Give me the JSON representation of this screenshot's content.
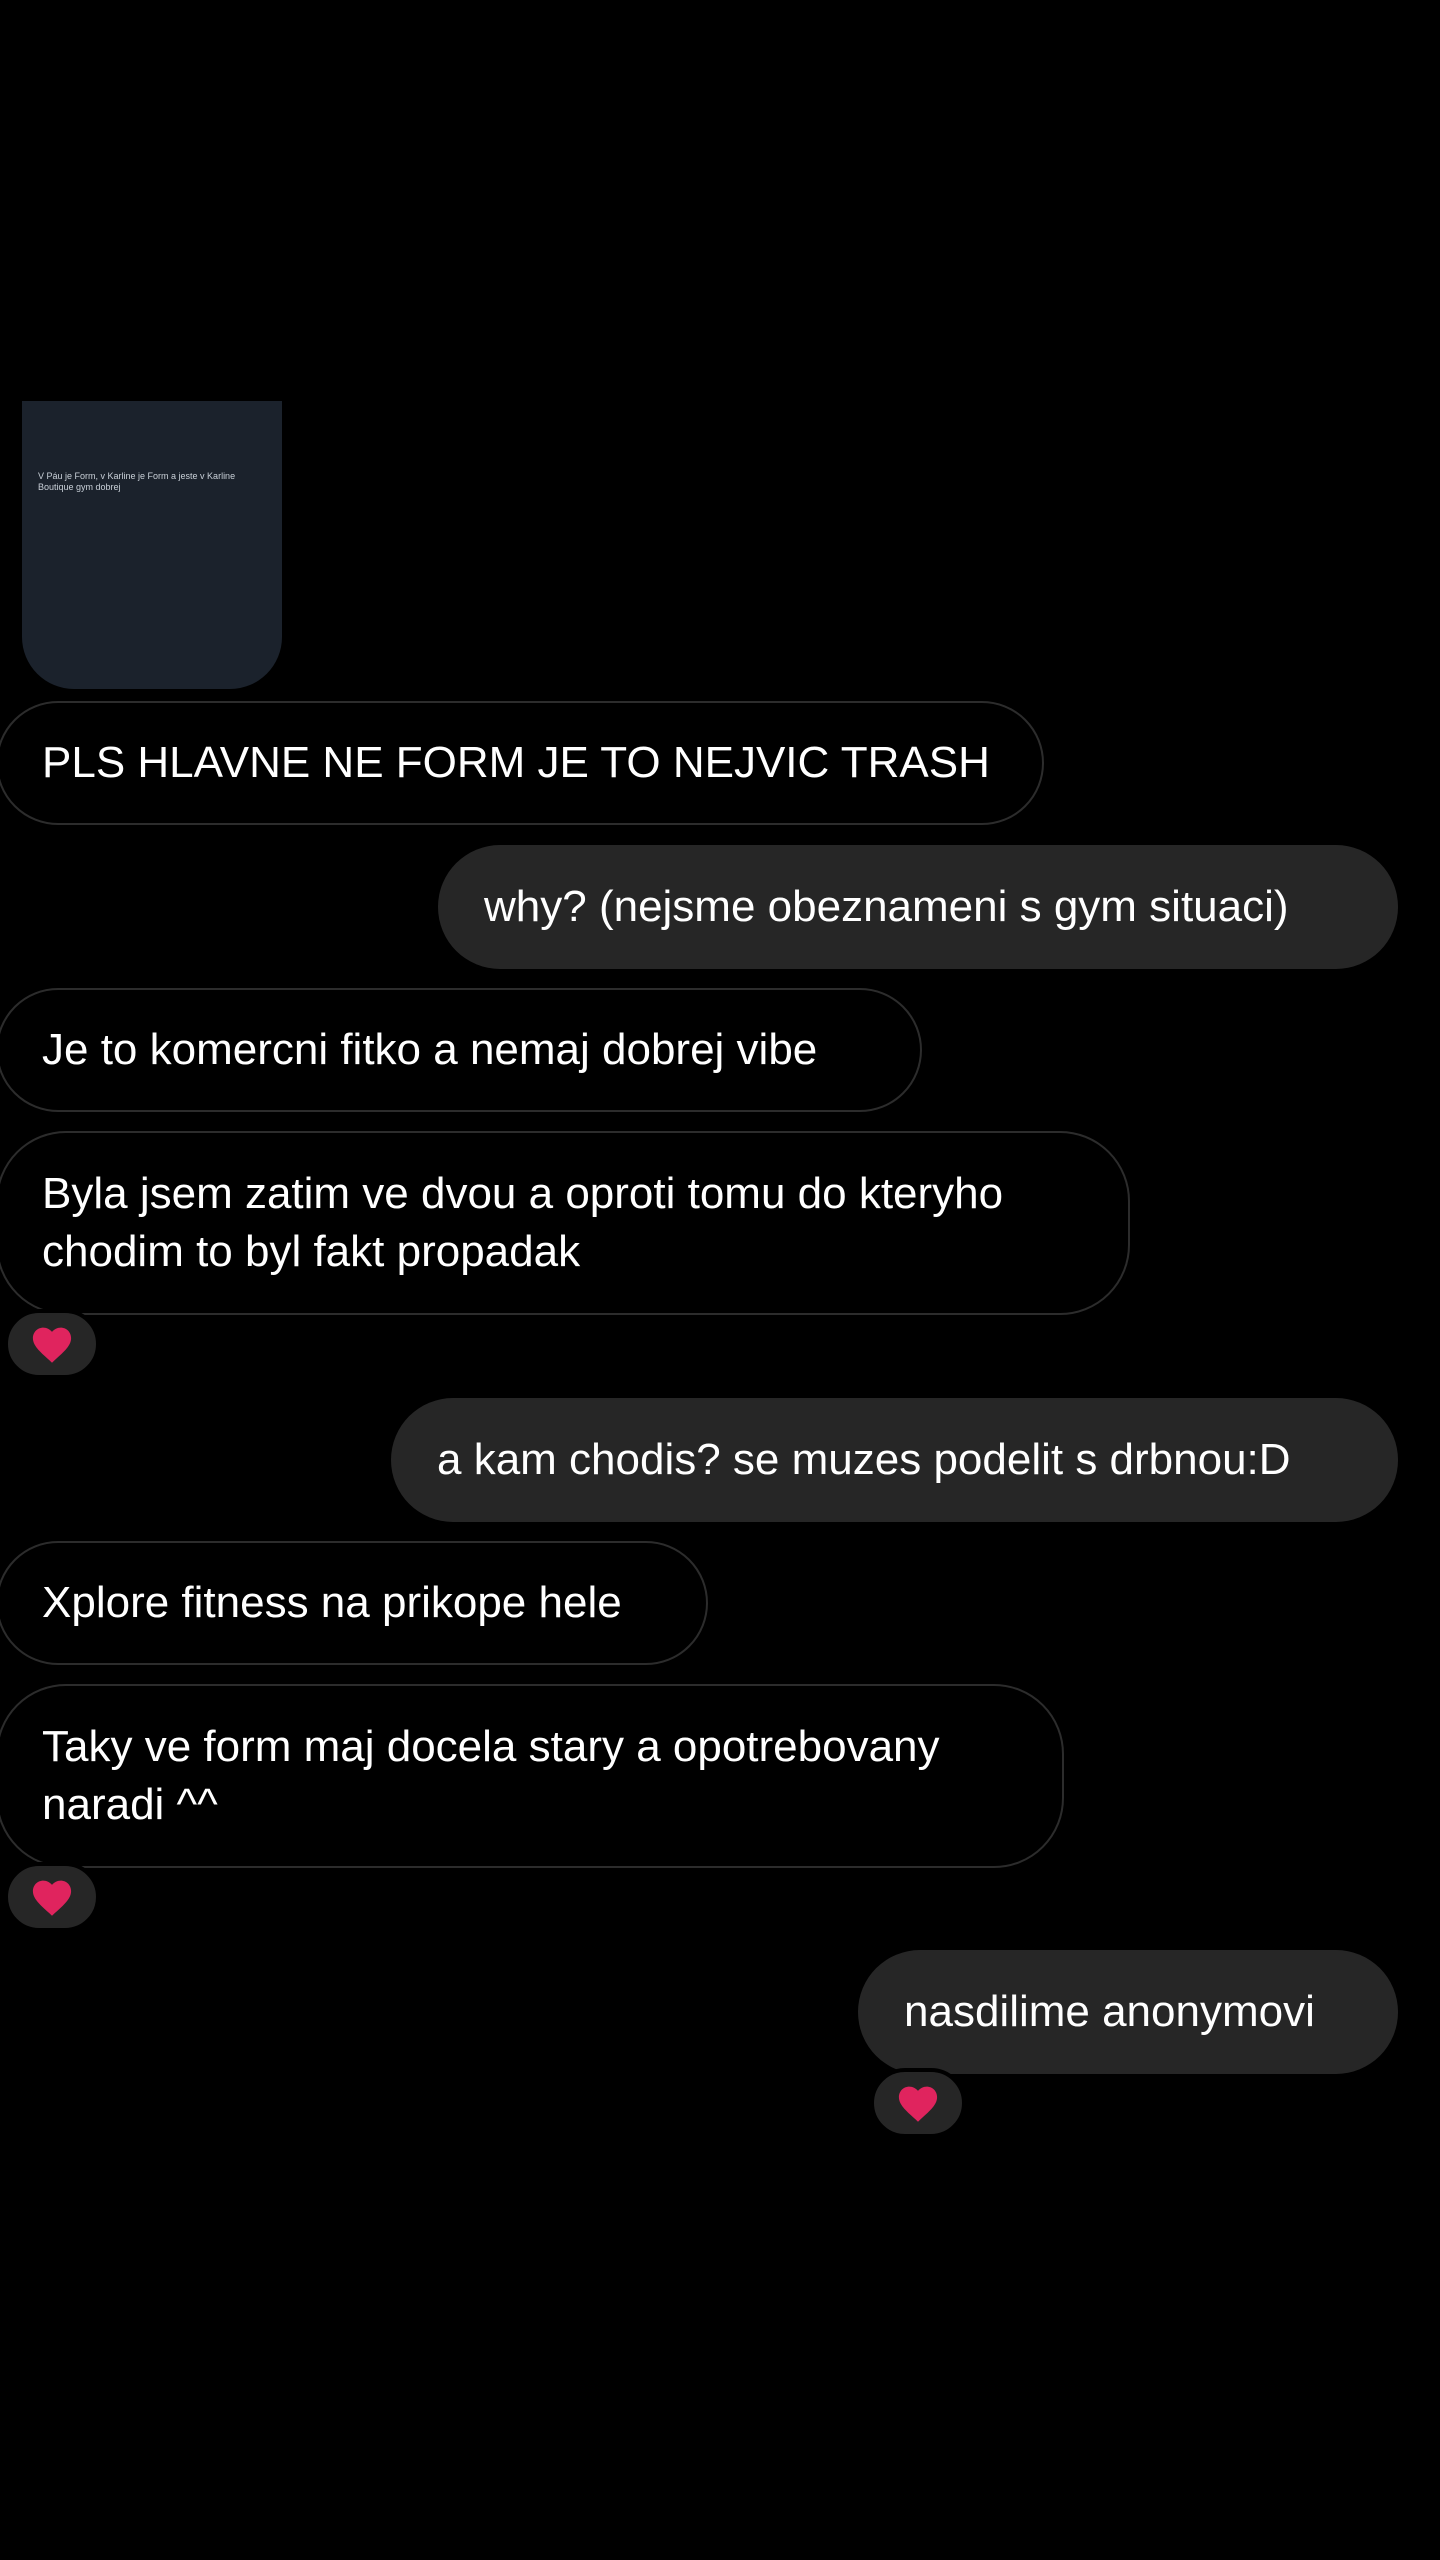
{
  "story_reply": {
    "text": "V Páu je Form, v Karline je Form a jeste v Karline Boutique gym dobrej"
  },
  "messages": [
    {
      "id": "m1",
      "text": "PLS HLAVNE NE FORM JE TO NEJVIC TRASH"
    },
    {
      "id": "m2",
      "text": "why? (nejsme obeznameni s gym situaci)"
    },
    {
      "id": "m3",
      "text": "Je to komercni fitko a nemaj dobrej vibe"
    },
    {
      "id": "m4",
      "text": "Byla jsem zatim ve dvou a oproti tomu do kteryho chodim to byl fakt propadak"
    },
    {
      "id": "m5",
      "text": "a kam chodis? se muzes podelit s drbnou:D"
    },
    {
      "id": "m6",
      "text": "Xplore fitness na prikope hele"
    },
    {
      "id": "m7",
      "text": "Taky ve form maj docela stary a opotrebovany naradi ^^"
    },
    {
      "id": "m8",
      "text": "nasdilime anonymovi"
    }
  ],
  "reactions": {
    "m4": "heart-icon",
    "m7": "heart-icon",
    "m8": "heart-icon"
  },
  "colors": {
    "background": "#000000",
    "outgoing_bubble": "#262626",
    "incoming_border": "#2c2c2c",
    "story_card": "#1b222c",
    "heart": "#e0245e"
  }
}
